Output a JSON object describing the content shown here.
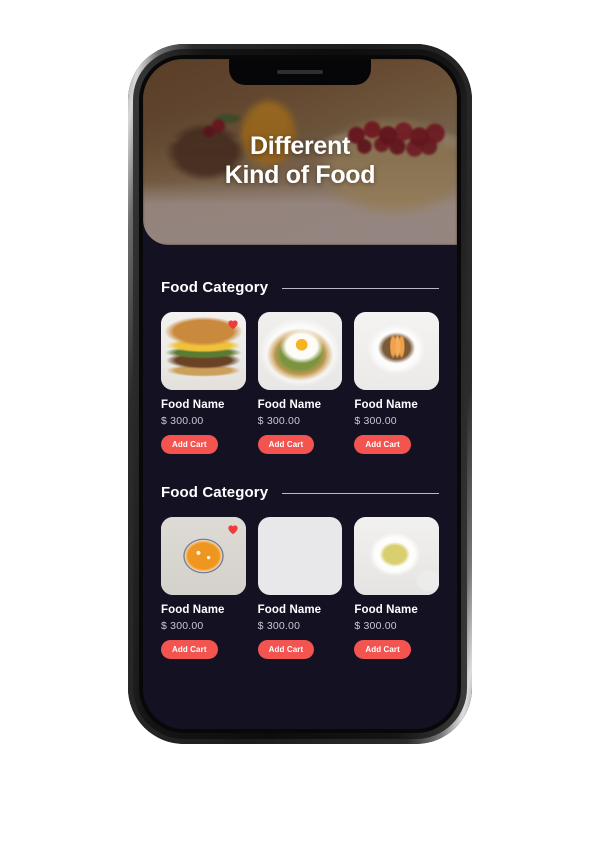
{
  "device": {
    "notch_icon": "speaker-grill-icon"
  },
  "hero": {
    "title_line1": "Different",
    "title_line2": "Kind of Food"
  },
  "sections": [
    {
      "title": "Food Category",
      "cards": [
        {
          "image": "burger-photo",
          "favorite": true,
          "name": "Food Name",
          "price": "$ 300.00",
          "cta": "Add Cart"
        },
        {
          "image": "egg-toast-photo",
          "favorite": false,
          "name": "Food Name",
          "price": "$ 300.00",
          "cta": "Add Cart"
        },
        {
          "image": "peach-granola-photo",
          "favorite": false,
          "name": "Food Name",
          "price": "$ 300.00",
          "cta": "Add Cart"
        }
      ]
    },
    {
      "title": "Food Category",
      "cards": [
        {
          "image": "pumpkin-soup-photo",
          "favorite": true,
          "name": "Food Name",
          "price": "$ 300.00",
          "cta": "Add Cart"
        },
        {
          "image": "waffles-photo",
          "favorite": false,
          "name": "Food Name",
          "price": "$ 300.00",
          "cta": "Add Cart"
        },
        {
          "image": "pasta-photo",
          "favorite": false,
          "name": "Food Name",
          "price": "$ 300.00",
          "cta": "Add Cart"
        }
      ]
    }
  ],
  "colors": {
    "screen_background": "#141123",
    "accent": "#f4544f",
    "heart": "#ef3b3b",
    "title_text": "#ffffff",
    "price_text": "#c9c7d2",
    "rule": "#b9b9c4"
  }
}
